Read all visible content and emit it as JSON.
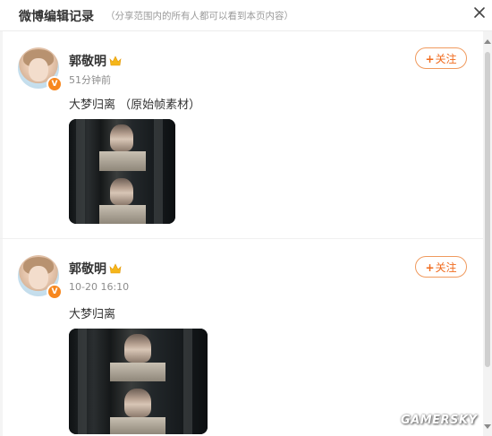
{
  "header": {
    "title": "微博编辑记录",
    "subtitle": "（分享范围内的所有人都可以看到本页内容）"
  },
  "posts": [
    {
      "user": "郭敬明",
      "time": "51分钟前",
      "text": "大梦归离 （原始帧素材）",
      "follow_label": "关注",
      "follow_plus": "+"
    },
    {
      "user": "郭敬明",
      "time": "10-20 16:10",
      "text": "大梦归离",
      "follow_label": "关注",
      "follow_plus": "+"
    }
  ],
  "badge": {
    "verify_mark": "V"
  },
  "watermark": "GAMERSKY",
  "colors": {
    "accent": "#f06b1e",
    "verify_badge": "#f7871e",
    "crown": "#f5b61a"
  },
  "icons": [
    "close-icon",
    "crown-icon",
    "verified-badge-icon"
  ]
}
